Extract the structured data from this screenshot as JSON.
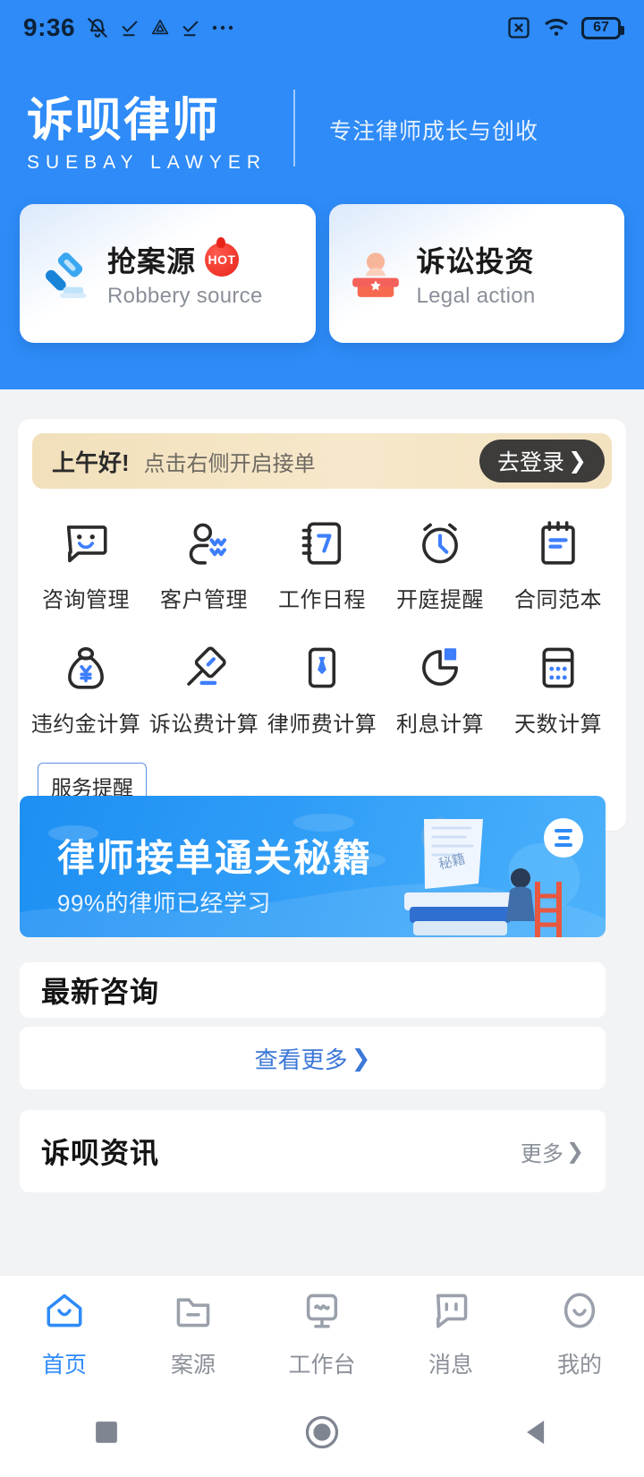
{
  "status_bar": {
    "time": "9:36",
    "left_icons": [
      "mute-bell-icon",
      "check-underline-icon",
      "triangle-drive-icon",
      "check-underline-icon",
      "ellipsis-icon"
    ],
    "right_icons": [
      "sim-x-icon",
      "wifi-icon"
    ],
    "battery_level": "67"
  },
  "brand": {
    "name_cn": "诉呗律师",
    "name_en": "SUEBAY LAWYER",
    "tagline": "专注律师成长与创收"
  },
  "hero_cards": [
    {
      "title": "抢案源",
      "subtitle": "Robbery source",
      "badge": "HOT",
      "icon": "gavel-icon"
    },
    {
      "title": "诉讼投资",
      "subtitle": "Legal action",
      "badge": "",
      "icon": "judge-podium-icon"
    }
  ],
  "greeting": {
    "salutation": "上午好!",
    "hint": "点击右侧开启接单",
    "login_button": "去登录",
    "chevron": "❯"
  },
  "grid": [
    {
      "label": "咨询管理",
      "icon": "chat-smiley-icon"
    },
    {
      "label": "客户管理",
      "icon": "user-customer-icon"
    },
    {
      "label": "工作日程",
      "icon": "calendar-7-icon"
    },
    {
      "label": "开庭提醒",
      "icon": "alarm-clock-icon"
    },
    {
      "label": "合同范本",
      "icon": "clipboard-icon"
    },
    {
      "label": "违约金计算",
      "icon": "money-bag-yuan-icon"
    },
    {
      "label": "诉讼费计算",
      "icon": "gavel-pen-icon"
    },
    {
      "label": "律师费计算",
      "icon": "necktie-card-icon"
    },
    {
      "label": "利息计算",
      "icon": "pie-chart-icon"
    },
    {
      "label": "天数计算",
      "icon": "calculator-icon"
    }
  ],
  "service_chip": "服务提醒",
  "promo": {
    "title": "律师接单通关秘籍",
    "subtitle": "99%的律师已经学习",
    "menu_icon": "list-menu-icon"
  },
  "sections": {
    "consult_title": "最新咨询",
    "view_more": "查看更多",
    "view_more_chevron": "❯",
    "news_title": "诉呗资讯",
    "news_more": "更多",
    "news_more_chevron": "❯"
  },
  "tabbar": [
    {
      "label": "首页",
      "icon": "home-icon",
      "active": true
    },
    {
      "label": "案源",
      "icon": "folder-case-icon",
      "active": false
    },
    {
      "label": "工作台",
      "icon": "workbench-monitor-icon",
      "active": false
    },
    {
      "label": "消息",
      "icon": "message-chat-icon",
      "active": false
    },
    {
      "label": "我的",
      "icon": "profile-face-icon",
      "active": false
    }
  ],
  "android_nav": [
    "recent-square-icon",
    "home-circle-icon",
    "back-triangle-icon"
  ],
  "colors": {
    "brand_blue": "#2e8bf7",
    "page_bg": "#f2f3f5",
    "accent_link": "#3d78d8",
    "hot_red": "#e8241a",
    "greeting_bg": "#f2e0bb"
  }
}
